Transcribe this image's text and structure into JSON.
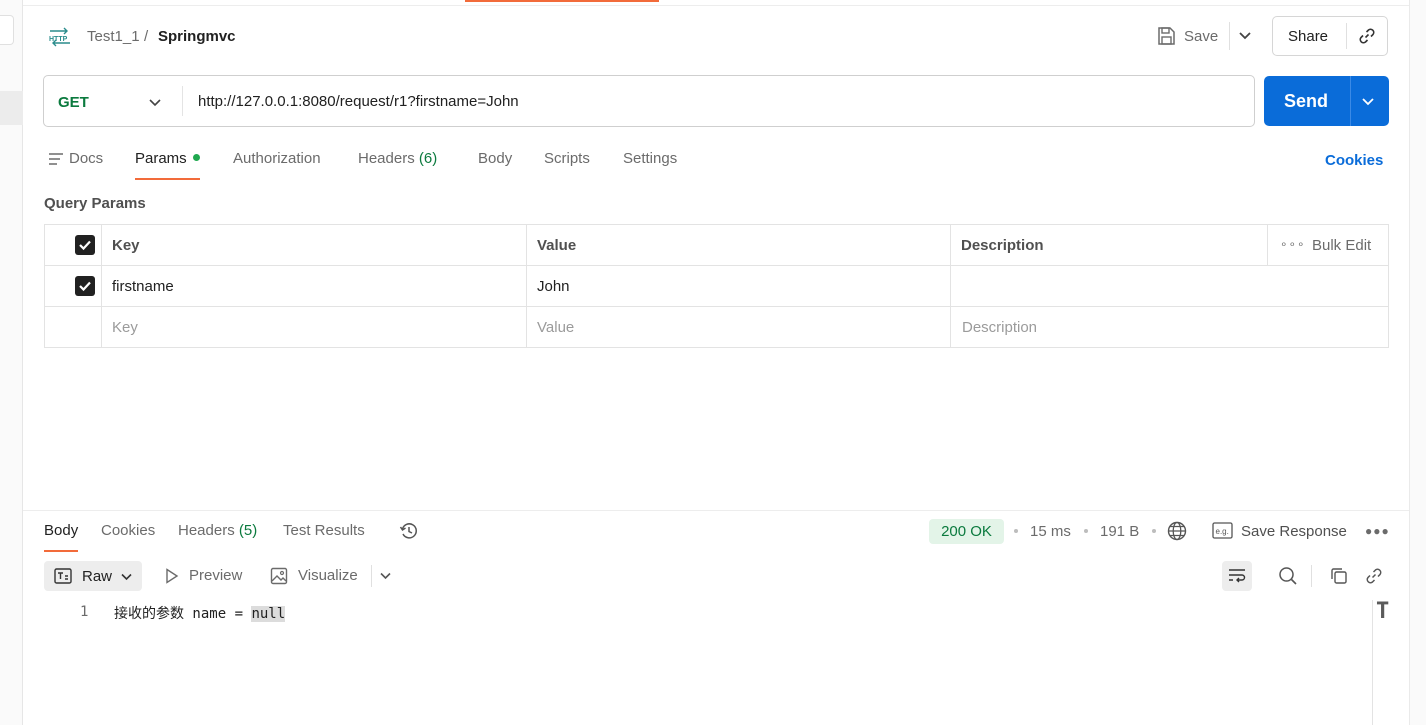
{
  "breadcrumb": {
    "collection": "Test1_1",
    "separator": "/",
    "request": "Springmvc"
  },
  "header": {
    "save_label": "Save",
    "share_label": "Share"
  },
  "request": {
    "method": "GET",
    "url": "http://127.0.0.1:8080/request/r1?firstname=John",
    "send_label": "Send"
  },
  "request_tabs": [
    {
      "label": "Docs"
    },
    {
      "label": "Params"
    },
    {
      "label": "Authorization"
    },
    {
      "label": "Headers",
      "count": "(6)"
    },
    {
      "label": "Body"
    },
    {
      "label": "Scripts"
    },
    {
      "label": "Settings"
    }
  ],
  "active_request_tab": "Params",
  "cookies_label": "Cookies",
  "query_params": {
    "title": "Query Params",
    "columns": {
      "key": "Key",
      "value": "Value",
      "description": "Description"
    },
    "bulk_edit_label": "Bulk Edit",
    "rows": [
      {
        "enabled": true,
        "key": "firstname",
        "value": "John",
        "description": ""
      }
    ],
    "placeholder": {
      "key": "Key",
      "value": "Value",
      "description": "Description"
    }
  },
  "response": {
    "tabs": [
      {
        "label": "Body"
      },
      {
        "label": "Cookies"
      },
      {
        "label": "Headers",
        "count": "(5)"
      },
      {
        "label": "Test Results"
      }
    ],
    "active_tab": "Body",
    "status": "200 OK",
    "time": "15 ms",
    "size": "191 B",
    "save_response_label": "Save Response",
    "format": {
      "selected": "Raw",
      "preview": "Preview",
      "visualize": "Visualize"
    },
    "body": {
      "line_number": "1",
      "text_prefix": "接收的参数 name = ",
      "text_highlight": "null"
    }
  },
  "colors": {
    "accent": "#f26b3a",
    "send_blue": "#0a6cd9",
    "method_green": "#0b7a3e",
    "status_bg": "#e3f4e8"
  },
  "icons": [
    "http-icon",
    "save-icon",
    "chevron-down-icon",
    "link-icon",
    "docs-icon",
    "history-icon",
    "globe-icon",
    "save-response-icon",
    "more-icon",
    "raw-icon",
    "play-icon",
    "image-icon",
    "wrap-icon",
    "search-icon",
    "copy-icon"
  ]
}
